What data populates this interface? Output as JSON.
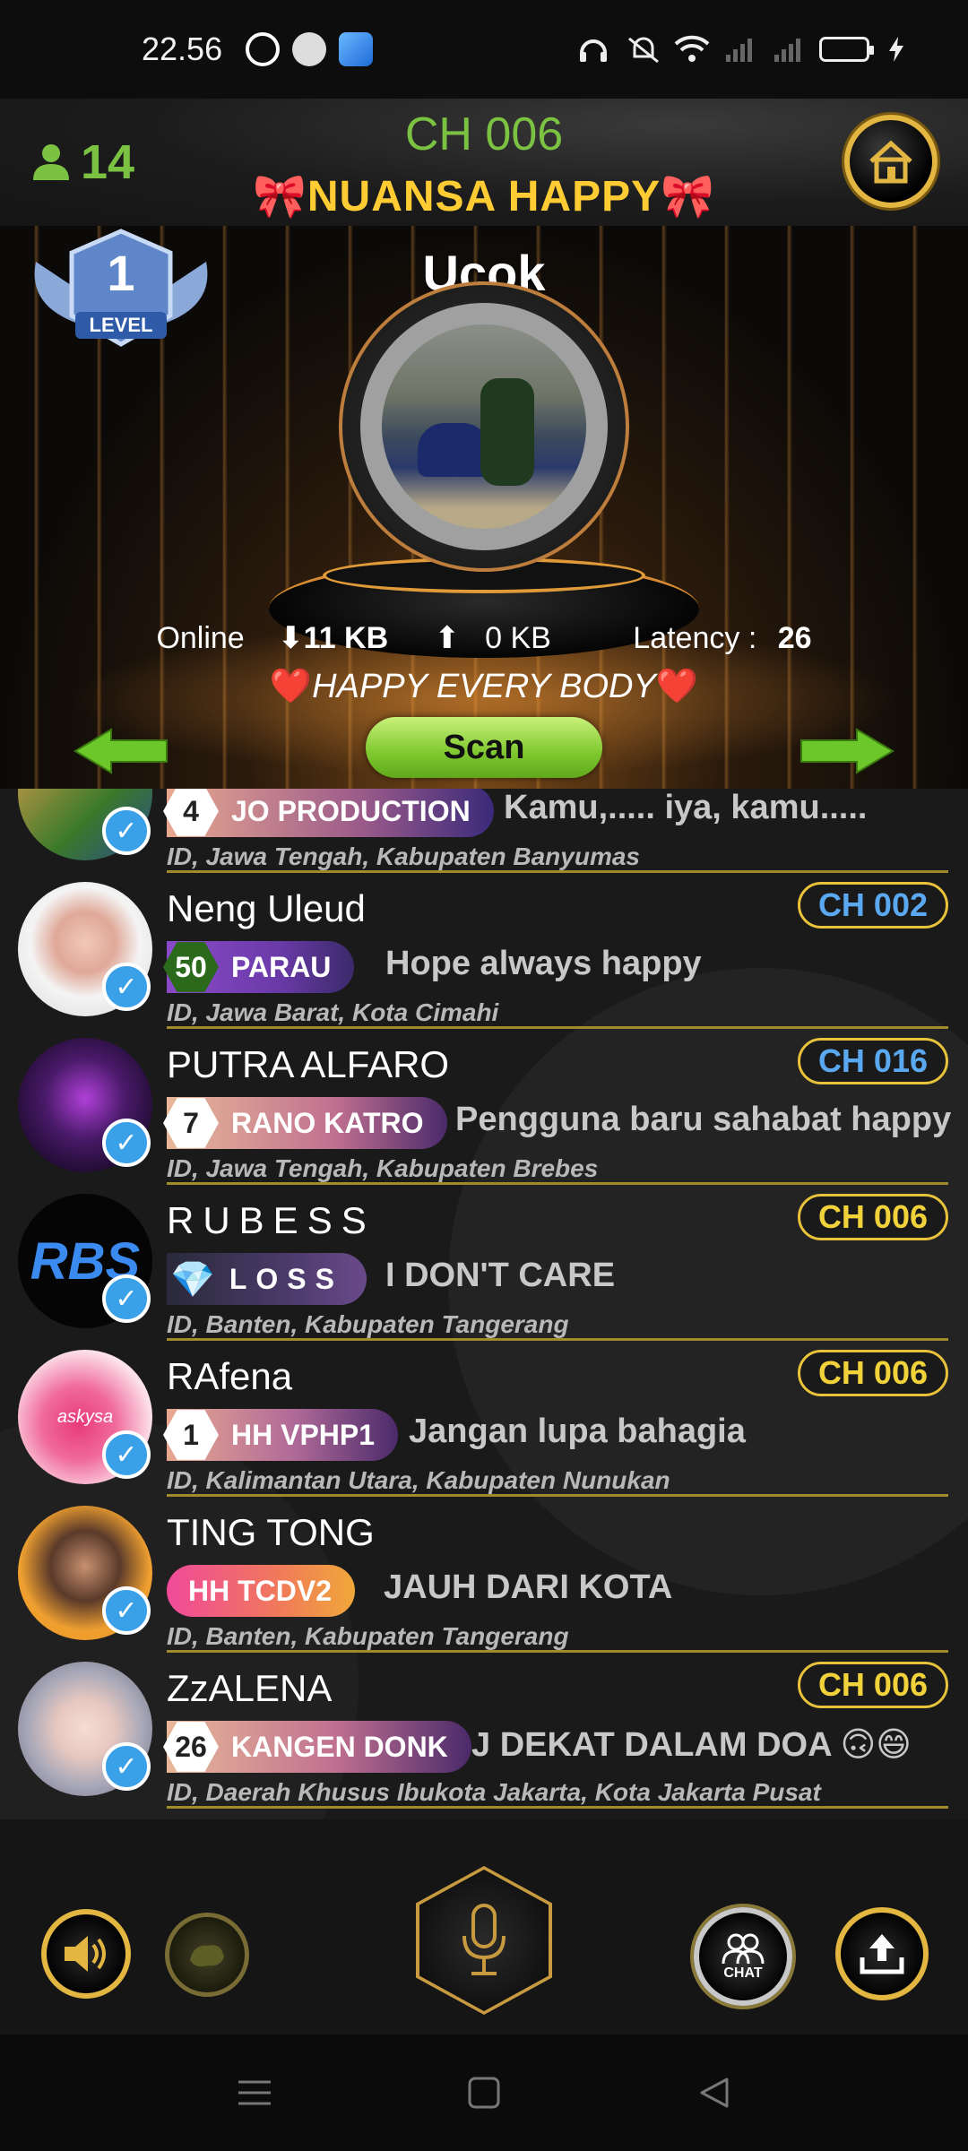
{
  "status_bar": {
    "time": "22.56"
  },
  "header": {
    "online_count": "14",
    "channel_code": "CH 006",
    "room_name": "NUANSA HAPPY"
  },
  "stage": {
    "level_number": "1",
    "level_label": "LEVEL",
    "speaker_name": "Ucok",
    "stats": {
      "online_label": "Online",
      "download": "11 KB",
      "upload": "0 KB",
      "latency_label": "Latency :",
      "latency_value": "26"
    },
    "greeting": "HAPPY EVERY BODY",
    "scan_label": "Scan"
  },
  "users": [
    {
      "name": "",
      "level": "4",
      "tag": "JO PRODUCTION",
      "status": "Kamu,..... iya, kamu.....",
      "location": "ID, Jawa Tengah, Kabupaten Banyumas",
      "channel": ""
    },
    {
      "name": "Neng Uleud",
      "level": "50",
      "tag": "PARAU",
      "status": "Hope always happy",
      "location": "ID, Jawa Barat, Kota Cimahi",
      "channel": "CH 002"
    },
    {
      "name": "PUTRA ALFARO",
      "level": "7",
      "tag": "RANO KATRO",
      "status": "Pengguna baru sahabat happy",
      "location": "ID, Jawa Tengah, Kabupaten Brebes",
      "channel": "CH 016"
    },
    {
      "name": "RUBESS",
      "level": "",
      "tag": "LOSS",
      "status": "I DON'T CARE",
      "location": "ID, Banten, Kabupaten Tangerang",
      "channel": "CH 006",
      "avatar_text": "RBS"
    },
    {
      "name": "RAfena",
      "level": "1",
      "tag": "HH  VPHP1",
      "status": "Jangan lupa bahagia",
      "location": "ID, Kalimantan Utara, Kabupaten Nunukan",
      "channel": "CH 006",
      "avatar_text": "askysa"
    },
    {
      "name": "TING TONG",
      "level": "",
      "tag": "HH  TCDV2",
      "status": "JAUH DARI KOTA",
      "location": "ID, Banten, Kabupaten Tangerang",
      "channel": ""
    },
    {
      "name": "ZzALENA",
      "level": "26",
      "tag": "KANGEN DONK",
      "status": "J DEKAT DALAM DOA 🙃😄",
      "location": "ID, Daerah Khusus Ibukota Jakarta, Kota Jakarta Pusat",
      "channel": "CH 006"
    }
  ],
  "controls": {
    "chat_label": "CHAT"
  },
  "colors": {
    "accent_gold": "#e2b640",
    "online_green": "#7bc242",
    "room_yellow": "#ffcc33"
  }
}
